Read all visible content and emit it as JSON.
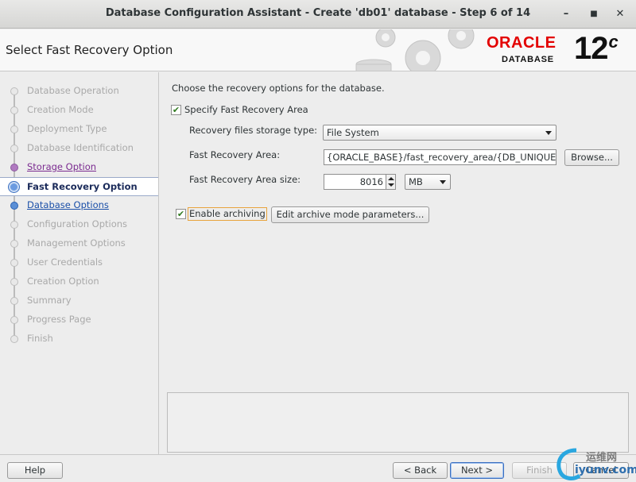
{
  "window": {
    "title": "Database Configuration Assistant - Create 'db01' database - Step 6 of 14",
    "minimize": "–",
    "maximize": "■",
    "close": "✕"
  },
  "header": {
    "page_title": "Select Fast Recovery Option",
    "brand": "ORACLE",
    "brand_sub": "DATABASE",
    "version": "12",
    "version_suffix": "c"
  },
  "nav": {
    "items": [
      {
        "label": "Database Operation",
        "state": "done"
      },
      {
        "label": "Creation Mode",
        "state": "done"
      },
      {
        "label": "Deployment Type",
        "state": "done"
      },
      {
        "label": "Database Identification",
        "state": "done"
      },
      {
        "label": "Storage Option",
        "state": "visited"
      },
      {
        "label": "Fast Recovery Option",
        "state": "current"
      },
      {
        "label": "Database Options",
        "state": "link"
      },
      {
        "label": "Configuration Options",
        "state": "todo"
      },
      {
        "label": "Management Options",
        "state": "todo"
      },
      {
        "label": "User Credentials",
        "state": "todo"
      },
      {
        "label": "Creation Option",
        "state": "todo"
      },
      {
        "label": "Summary",
        "state": "todo"
      },
      {
        "label": "Progress Page",
        "state": "todo"
      },
      {
        "label": "Finish",
        "state": "todo"
      }
    ]
  },
  "main": {
    "instructions": "Choose the recovery options for the database.",
    "specify_fra": {
      "label": "Specify Fast Recovery Area",
      "checked": true
    },
    "storage_type": {
      "label": "Recovery files storage type:",
      "value": "File System"
    },
    "fra_location": {
      "label": "Fast Recovery Area:",
      "value": "{ORACLE_BASE}/fast_recovery_area/{DB_UNIQUE_NAME}",
      "browse": "Browse..."
    },
    "fra_size": {
      "label": "Fast Recovery Area size:",
      "value": "8016",
      "unit": "MB"
    },
    "archiving": {
      "label": "Enable archiving",
      "checked": true,
      "edit_button": "Edit archive mode parameters..."
    }
  },
  "footer": {
    "help": "Help",
    "back": "< Back",
    "next": "Next >",
    "finish": "Finish",
    "cancel": "Cancel"
  },
  "watermark": {
    "cn": "运维网",
    "site": "iyunv.com"
  },
  "colors": {
    "oracle_red": "#e30000",
    "link_blue": "#1a4fa8",
    "visited_purple": "#7b2b90"
  }
}
